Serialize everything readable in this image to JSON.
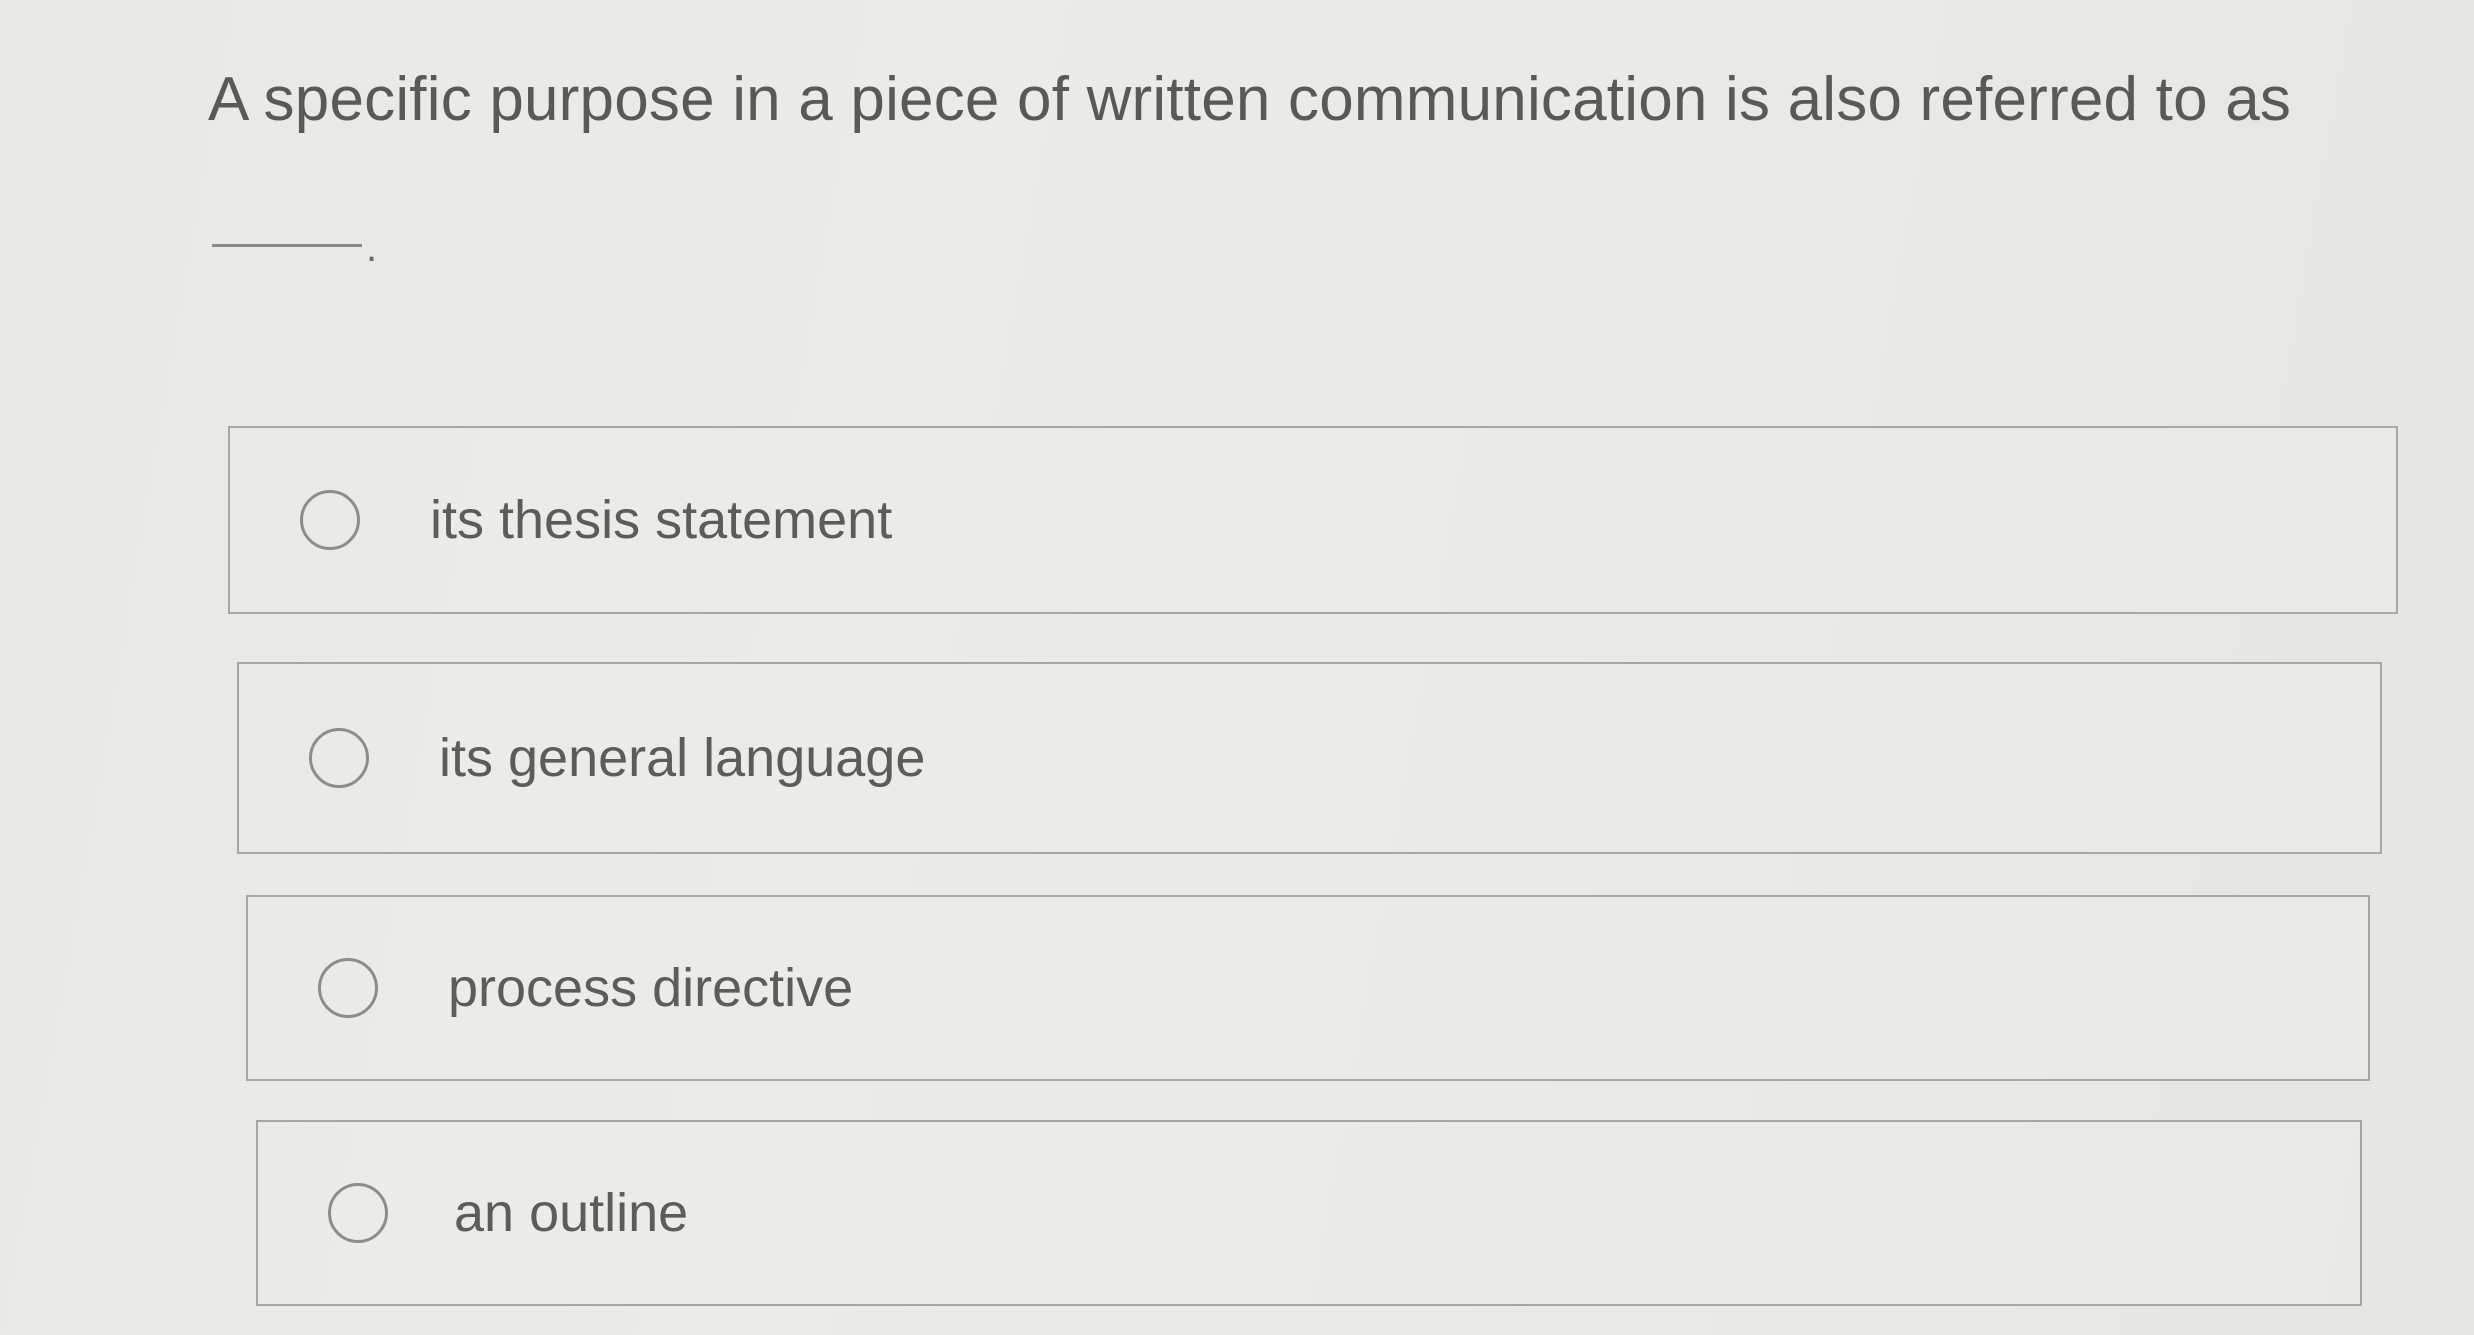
{
  "question": {
    "text": "A specific purpose in a piece of written communication is also referred to as",
    "blank_suffix": "."
  },
  "options": [
    {
      "label": "its thesis statement",
      "selected": false
    },
    {
      "label": "its general language",
      "selected": false
    },
    {
      "label": "process directive",
      "selected": false
    },
    {
      "label": "an outline",
      "selected": false
    }
  ]
}
